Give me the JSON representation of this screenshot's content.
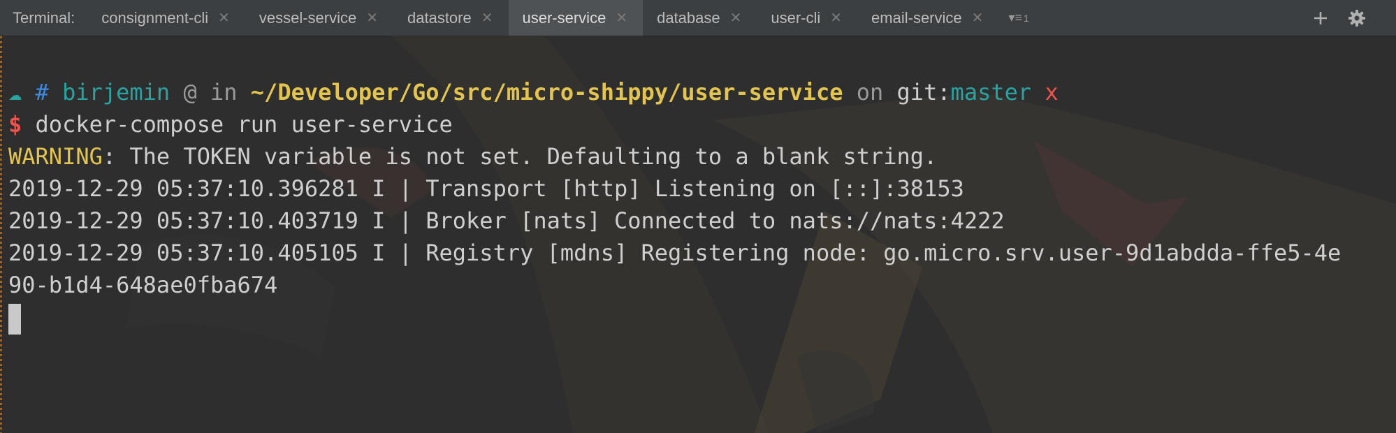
{
  "tabbar": {
    "label": "Terminal:",
    "tabs": [
      {
        "label": "consignment-cli",
        "active": false
      },
      {
        "label": "vessel-service",
        "active": false
      },
      {
        "label": "datastore",
        "active": false
      },
      {
        "label": "user-service",
        "active": true
      },
      {
        "label": "database",
        "active": false
      },
      {
        "label": "user-cli",
        "active": false
      },
      {
        "label": "email-service",
        "active": false
      }
    ],
    "hidden_tabs_count": "1",
    "icons": {
      "close": "close-icon",
      "list": "tab-list-icon",
      "add": "plus-icon",
      "settings": "gear-icon"
    }
  },
  "terminal": {
    "prompt": {
      "arrow": "☁",
      "hash": "#",
      "user": "birjemin",
      "at": "@",
      "in": "in",
      "path": "~/Developer/Go/src/micro-shippy/user-service",
      "on": "on",
      "git_prefix": "git:",
      "branch": "master",
      "dirty": "x"
    },
    "command": {
      "dollar": "$",
      "text": "docker-compose run user-service"
    },
    "warning": {
      "label": "WARNING",
      "text": ": The TOKEN variable is not set. Defaulting to a blank string."
    },
    "log_lines": [
      "2019-12-29 05:37:10.396281 I | Transport [http] Listening on [::]:38153",
      "2019-12-29 05:37:10.403719 I | Broker [nats] Connected to nats://nats:4222",
      "2019-12-29 05:37:10.405105 I | Registry [mdns] Registering node: go.micro.srv.user-9d1abdda-ffe5-4e",
      "90-b1d4-648ae0fba674"
    ],
    "colors": {
      "background": "#2e2e2e",
      "cyan": "#2aa3a3",
      "blue": "#3d8ae0",
      "yellow": "#e3c451",
      "red": "#ef5350",
      "text": "#cfcfcf"
    }
  }
}
